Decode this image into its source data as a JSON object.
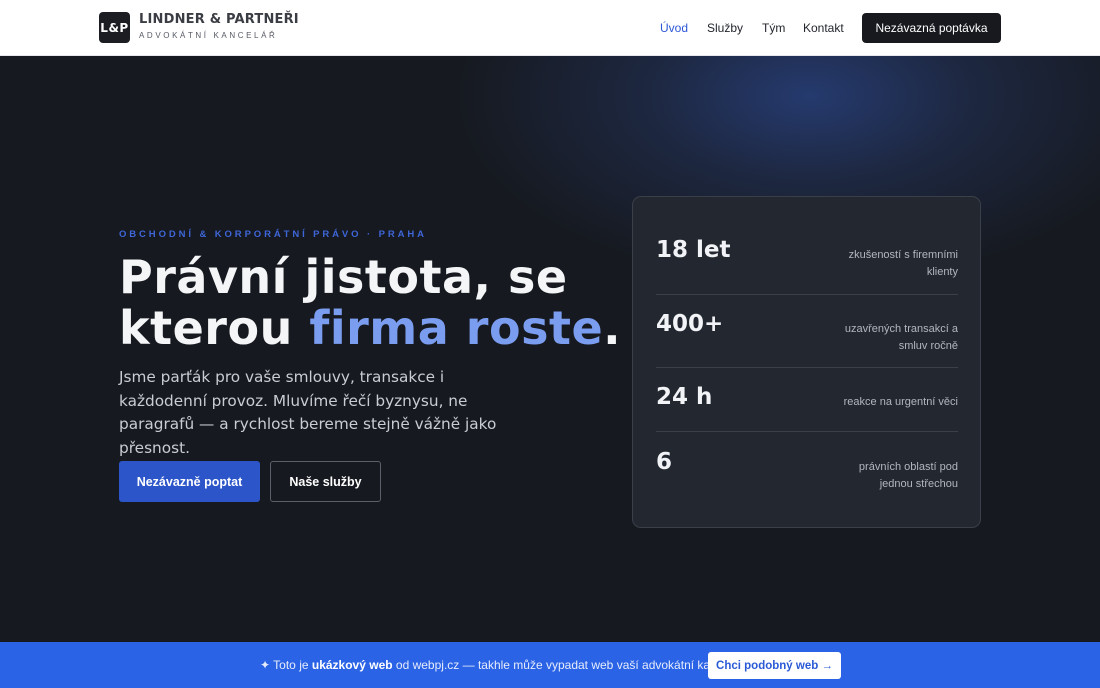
{
  "header": {
    "logo_mark": "L&P",
    "logo_name": "LINDNER & PARTNEŘI",
    "logo_sub": "ADVOKÁTNÍ KANCELÁŘ",
    "nav": [
      {
        "label": "Úvod",
        "active": true
      },
      {
        "label": "Služby"
      },
      {
        "label": "Tým"
      },
      {
        "label": "Kontakt"
      }
    ],
    "cta_label": "Nezávazná poptávka"
  },
  "hero": {
    "eyebrow": "OBCHODNÍ & KORPORÁTNÍ PRÁVO · PRAHA",
    "headline_line1": "Právní jistota, se",
    "headline_line2_start": "kterou ",
    "headline_accent": "firma roste",
    "headline_end": ".",
    "lead": "Jsme parťák pro vaše smlouvy, transakce i každodenní provoz. Mluvíme řečí byznysu, ne paragrafů — a rychlost bereme stejně vážně jako přesnost.",
    "primary_button": "Nezávazně poptat",
    "secondary_button": "Naše služby"
  },
  "stats": [
    {
      "value": "18 let",
      "label": "zkušeností s firemními klienty"
    },
    {
      "value": "400+",
      "label": "uzavřených transakcí a smluv ročně"
    },
    {
      "value": "24 h",
      "label": "reakce na urgentní věci"
    },
    {
      "value": "6",
      "label": "právních oblastí pod jednou střechou"
    }
  ],
  "banner": {
    "prefix": "✦ Toto je ",
    "bold": "ukázkový web",
    "suffix": " od webpj.cz — takhle může vypadat web vaší advokátní kanceláře.",
    "button": "Chci podobný web →"
  },
  "colors": {
    "accent": "#2b55c9",
    "headline_accent": "#7b9df0",
    "background": "#16191f",
    "banner": "#2a63e6"
  }
}
